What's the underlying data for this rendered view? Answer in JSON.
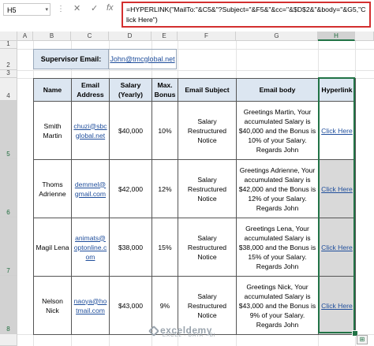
{
  "namebox": {
    "value": "H5"
  },
  "formula_bar": {
    "dots": "⋮",
    "cancel_icon": "✕",
    "enter_icon": "✓",
    "fx": "fx",
    "formula": "=HYPERLINK(\"MailTo:\"&C5&\"?Subject=\"&F5&\"&cc=\"&$D$2&\"&body=\"&G5,\"Click Here\")"
  },
  "columns": [
    "A",
    "B",
    "C",
    "D",
    "E",
    "F",
    "G",
    "H"
  ],
  "rows": [
    "1",
    "2",
    "3",
    "4",
    "5",
    "6",
    "7",
    "8"
  ],
  "supervisor": {
    "label": "Supervisor Email:",
    "email": "John@tmcglobal.net"
  },
  "table": {
    "headers": [
      "Name",
      "Email Address",
      "Salary (Yearly)",
      "Max. Bonus",
      "Email Subject",
      "Email body",
      "Hyperlink"
    ],
    "rows": [
      {
        "name": "Smith Martin",
        "email": "chuzi@sbcglobal.net",
        "salary": "$40,000",
        "bonus": "10%",
        "subject": "Salary Restructured Notice",
        "body": "Greetings Martin, Your accumulated Salary is $40,000 and the Bonus is 10% of your Salary. Regards John",
        "link": "Click Here"
      },
      {
        "name": "Thoms Adrienne",
        "email": "demmel@gmail.com",
        "salary": "$42,000",
        "bonus": "12%",
        "subject": "Salary Restructured Notice",
        "body": "Greetings Adrienne, Your accumulated Salary is $42,000 and the Bonus is 12% of your Salary. Regards John",
        "link": "Click Here"
      },
      {
        "name": "Magil Lena",
        "email": "animats@optonline.com",
        "salary": "$38,000",
        "bonus": "15%",
        "subject": "Salary Restructured Notice",
        "body": "Greetings Lena, Your accumulated Salary is $38,000 and the Bonus is 15% of your Salary. Regards John",
        "link": "Click Here"
      },
      {
        "name": "Nelson Nick",
        "email": "naoya@hotmail.com",
        "salary": "$43,000",
        "bonus": "9%",
        "subject": "Salary Restructured Notice",
        "body": "Greetings Nick, Your accumulated Salary is $43,000 and the Bonus is 9% of your Salary. Regards John",
        "link": "Click Here"
      }
    ]
  },
  "watermark": {
    "name": "exceldemy",
    "tagline": "EXCEL · DATA · BI"
  },
  "quick_analysis_icon": "⊞"
}
